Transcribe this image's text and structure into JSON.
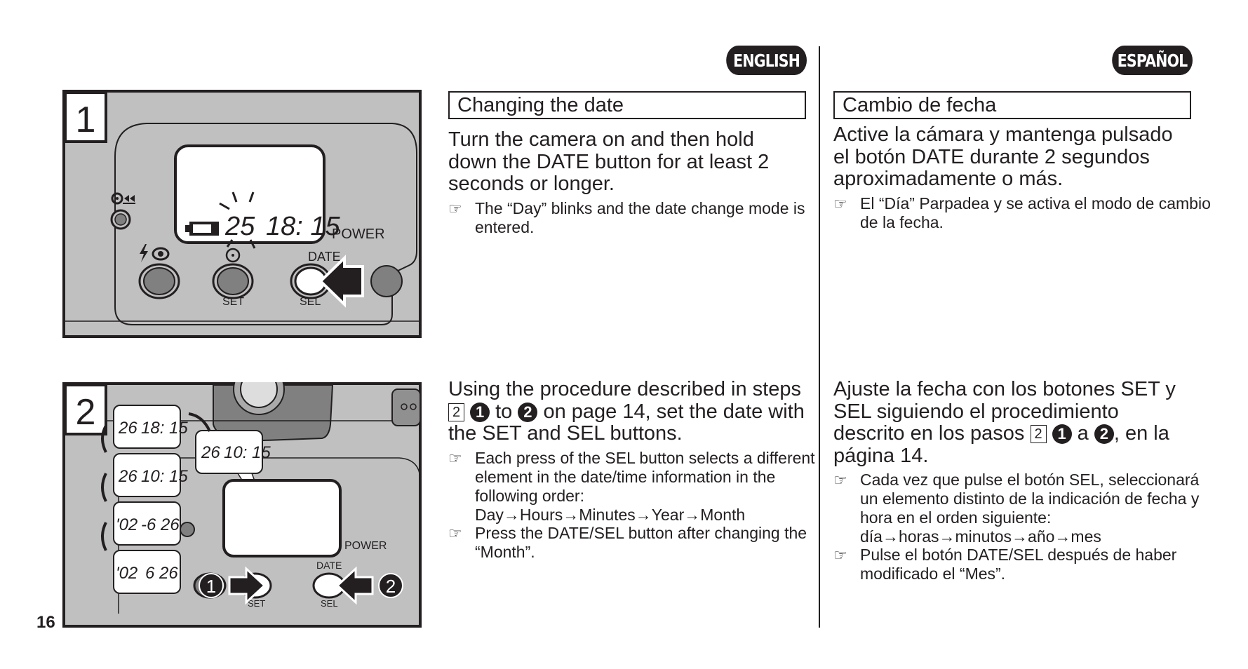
{
  "page_number": "16",
  "languages": {
    "left": "ENGLISH",
    "right": "ESPAÑOL"
  },
  "figures": {
    "fig1": {
      "step_number": "1",
      "lcd_day": "25",
      "lcd_time": "18: 15",
      "labels": {
        "power": "POWER",
        "date": "DATE",
        "set": "SET",
        "sel": "SEL"
      }
    },
    "fig2": {
      "step_number": "2",
      "lcd_sequence": [
        {
          "left": "26",
          "right": "18: 15",
          "blinking": "day"
        },
        {
          "left": "26",
          "right": "10: 15",
          "blinking": "hours"
        },
        {
          "left": "26",
          "right": "10: 15",
          "blinking": "minutes"
        },
        {
          "left": "'02",
          "right": "-6 26",
          "blinking": "year"
        },
        {
          "left": "'02",
          "right": "6 26",
          "blinking": "month"
        }
      ],
      "labels": {
        "power": "POWER",
        "date": "DATE",
        "set": "SET",
        "sel": "SEL"
      },
      "callouts": [
        "1",
        "2"
      ]
    }
  },
  "english": {
    "title": "Changing the date",
    "step1": {
      "body": "Turn the camera on and then hold down the DATE button for at least 2 seconds or longer.",
      "notes": [
        "The “Day” blinks and the date change mode is entered."
      ]
    },
    "step2": {
      "body_pre": "Using the procedure described in steps",
      "step_ref": "2",
      "circle_a": "1",
      "mid": "to",
      "circle_b": "2",
      "body_post": "on page 14, set the date with the SET and SEL buttons.",
      "notes": [
        "Each press of the SEL button selects a different element in the date/time information in the following order:",
        "Press the DATE/SEL button after changing the “Month”."
      ],
      "order": "Day→Hours→Minutes→Year→Month"
    }
  },
  "spanish": {
    "title": "Cambio de fecha",
    "step1": {
      "body": "Active la cámara y mantenga pulsado el botón DATE durante 2 segundos aproximadamente o más.",
      "notes": [
        "El “Día” Parpadea y se activa el modo de cambio de la fecha."
      ]
    },
    "step2": {
      "body_pre": "Ajuste la fecha con los botones SET y SEL siguiendo el procedimiento descrito en los pasos",
      "step_ref": "2",
      "circle_a": "1",
      "mid": "a",
      "circle_b": "2",
      "body_post": ", en la página 14.",
      "notes": [
        "Cada vez que pulse el botón SEL, seleccionará un elemento distinto de la indicación de fecha y hora en el orden siguiente:",
        "Pulse el botón DATE/SEL después de haber modificado el “Mes”."
      ],
      "order": "día→horas→minutos→año→mes"
    }
  }
}
